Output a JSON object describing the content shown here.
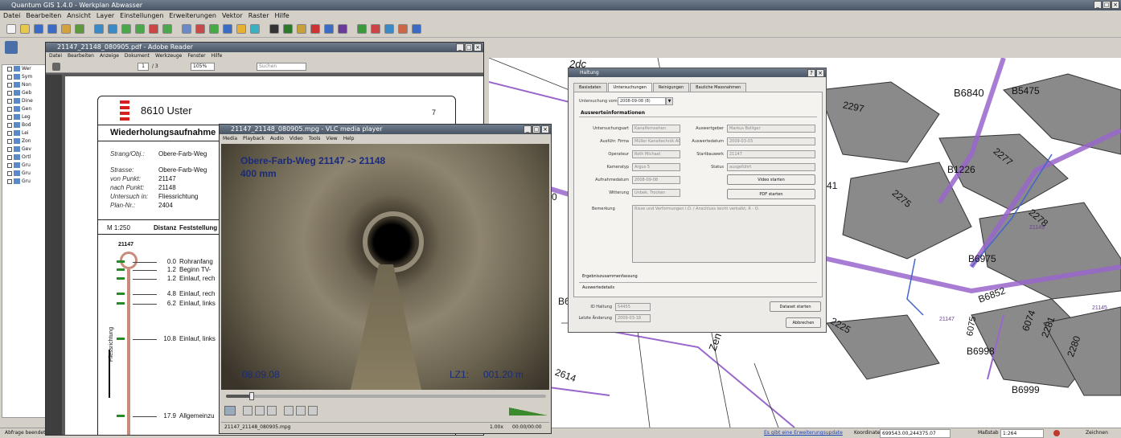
{
  "qgis": {
    "title": "Quantum GIS 1.4.0 - Werkplan Abwasser",
    "menu": [
      "Datei",
      "Bearbeiten",
      "Ansicht",
      "Layer",
      "Einstellungen",
      "Erweiterungen",
      "Vektor",
      "Raster",
      "Hilfe"
    ],
    "status_left": "Abfrage beendet",
    "status_link": "Es gibt eine Erweiterungsupdate",
    "coord_label": "Koordinate:",
    "coord_value": "699543.00,244375.07",
    "scale_label": "Maßstab",
    "scale_value": "1:264",
    "render_label": "Zeichnen"
  },
  "layers": [
    "Wer",
    "Sym",
    "Non",
    "Geb",
    "Dine",
    "Gen",
    "Leg",
    "Bod",
    "Lei",
    "Zon",
    "Gev",
    "Ortl",
    "Gru",
    "Gru",
    "Gru"
  ],
  "reader": {
    "title": "21147_21148_080905.pdf - Adobe Reader",
    "menu": [
      "Datei",
      "Bearbeiten",
      "Anzeige",
      "Dokument",
      "Werkzeuge",
      "Fenster",
      "Hilfe"
    ],
    "page": "1",
    "pages": "/ 3",
    "zoom": "105%",
    "search": "Suchen",
    "doc": {
      "town": "8610 Uster",
      "page_no": "7",
      "heading": "Wiederholungsaufnahme",
      "rows": [
        {
          "k": "Strang/Obj.:",
          "v": "Obere-Farb-Weg"
        },
        {
          "k": "Strasse:",
          "v": "Obere-Farb-Weg"
        },
        {
          "k": "von Punkt:",
          "v": "21147"
        },
        {
          "k": "nach Punkt:",
          "v": "21148"
        },
        {
          "k": "Untersuch in:",
          "v": "Fliessrichtung"
        },
        {
          "k": "Plan-Nr.:",
          "v": "2404"
        }
      ],
      "scale": "M 1:250",
      "col_dist": "Distanz",
      "col_find": "Feststellung",
      "node": "21147",
      "flow": "Fliessrichtung",
      "events": [
        {
          "d": "0.0",
          "t": "Rohranfang"
        },
        {
          "d": "1.2",
          "t": "Beginn TV-"
        },
        {
          "d": "1.2",
          "t": "Einlauf, rech"
        },
        {
          "d": "4.8",
          "t": "Einlauf, rech"
        },
        {
          "d": "6.2",
          "t": "Einlauf, links"
        },
        {
          "d": "10.8",
          "t": "Einlauf, links"
        },
        {
          "d": "17.9",
          "t": "Allgemeinzu"
        }
      ]
    }
  },
  "vlc": {
    "title": "21147_21148_080905.mpg - VLC media player",
    "menu": [
      "Media",
      "Playback",
      "Audio",
      "Video",
      "Tools",
      "View",
      "Help"
    ],
    "overlay_title": "Obere-Farb-Weg 21147 -> 21148",
    "overlay_size": "400 mm",
    "overlay_date": "08.09.08",
    "overlay_lz_label": "LZ1:",
    "overlay_lz_value": "001.20 m",
    "progress": 0.08,
    "status_file": "21147_21148_080905.mpg",
    "speed": "1.00x",
    "time": "00:00/00:00"
  },
  "dialog": {
    "title": "Haltung",
    "tabs": [
      "Basisdaten",
      "Untersuchungen",
      "Reinigungen",
      "Bauliche Massnahmen"
    ],
    "active_tab": 1,
    "exam_label": "Untersuchung vom",
    "exam_value": "2008-09-08 (8)",
    "section": "Auswerteinformationen",
    "left_fields": [
      {
        "label": "Untersuchungsart",
        "value": "Kanalfernsehen"
      },
      {
        "label": "Ausführ. Firma",
        "value": "Müller Kanaltechnik AG"
      },
      {
        "label": "Operateur",
        "value": "Roth Michael"
      },
      {
        "label": "Kameratyp",
        "value": "Argus 5"
      },
      {
        "label": "Aufnahmedatum",
        "value": "2008-09-08"
      },
      {
        "label": "Witterung",
        "value": "Unbek. Trocken"
      }
    ],
    "right_fields": [
      {
        "label": "Auswertgeber",
        "value": "Markus Bolliger"
      },
      {
        "label": "Auswertedatum",
        "value": "2009-03-03"
      },
      {
        "label": "Startbauwerk",
        "value": "21147"
      },
      {
        "label": "Status",
        "value": "ausgeführt"
      }
    ],
    "btn_video": "Video starten",
    "btn_pdf": "PDF starten",
    "remark_label": "Bemerkung",
    "remark_value": "Risse und Verformungen i.O. / Anschluss leicht verkalkt, R - O.",
    "summary": "Ergebniszusammenfassung",
    "details": "Auswertedetails",
    "id_label": "ID Haltung",
    "id_value": "54455",
    "changed_label": "Letzte Änderung",
    "changed_value": "2009-03-18",
    "btn_save": "Dataset starten",
    "btn_cancel": "Abbrechen"
  },
  "map_labels": {
    "b6840": "B6840",
    "b5475": "B5475",
    "p2297": "2297",
    "b1226": "B1226",
    "p2277": "2277",
    "p2275": "2275",
    "p2278": "2278",
    "b6975": "B6975",
    "b6852": "B6852",
    "p6075": "6075",
    "p6074": "6074",
    "p2281": "2281",
    "b6998": "B6998",
    "p2280": "2280",
    "p2225": "2225",
    "b6999": "B6999",
    "p2614": "2614",
    "zen": "Zen",
    "p41": "41",
    "b6": "B6",
    "n0": "0",
    "top": "2dc",
    "p21145": "21145",
    "p21147": "21147",
    "p21145b": "21145"
  }
}
